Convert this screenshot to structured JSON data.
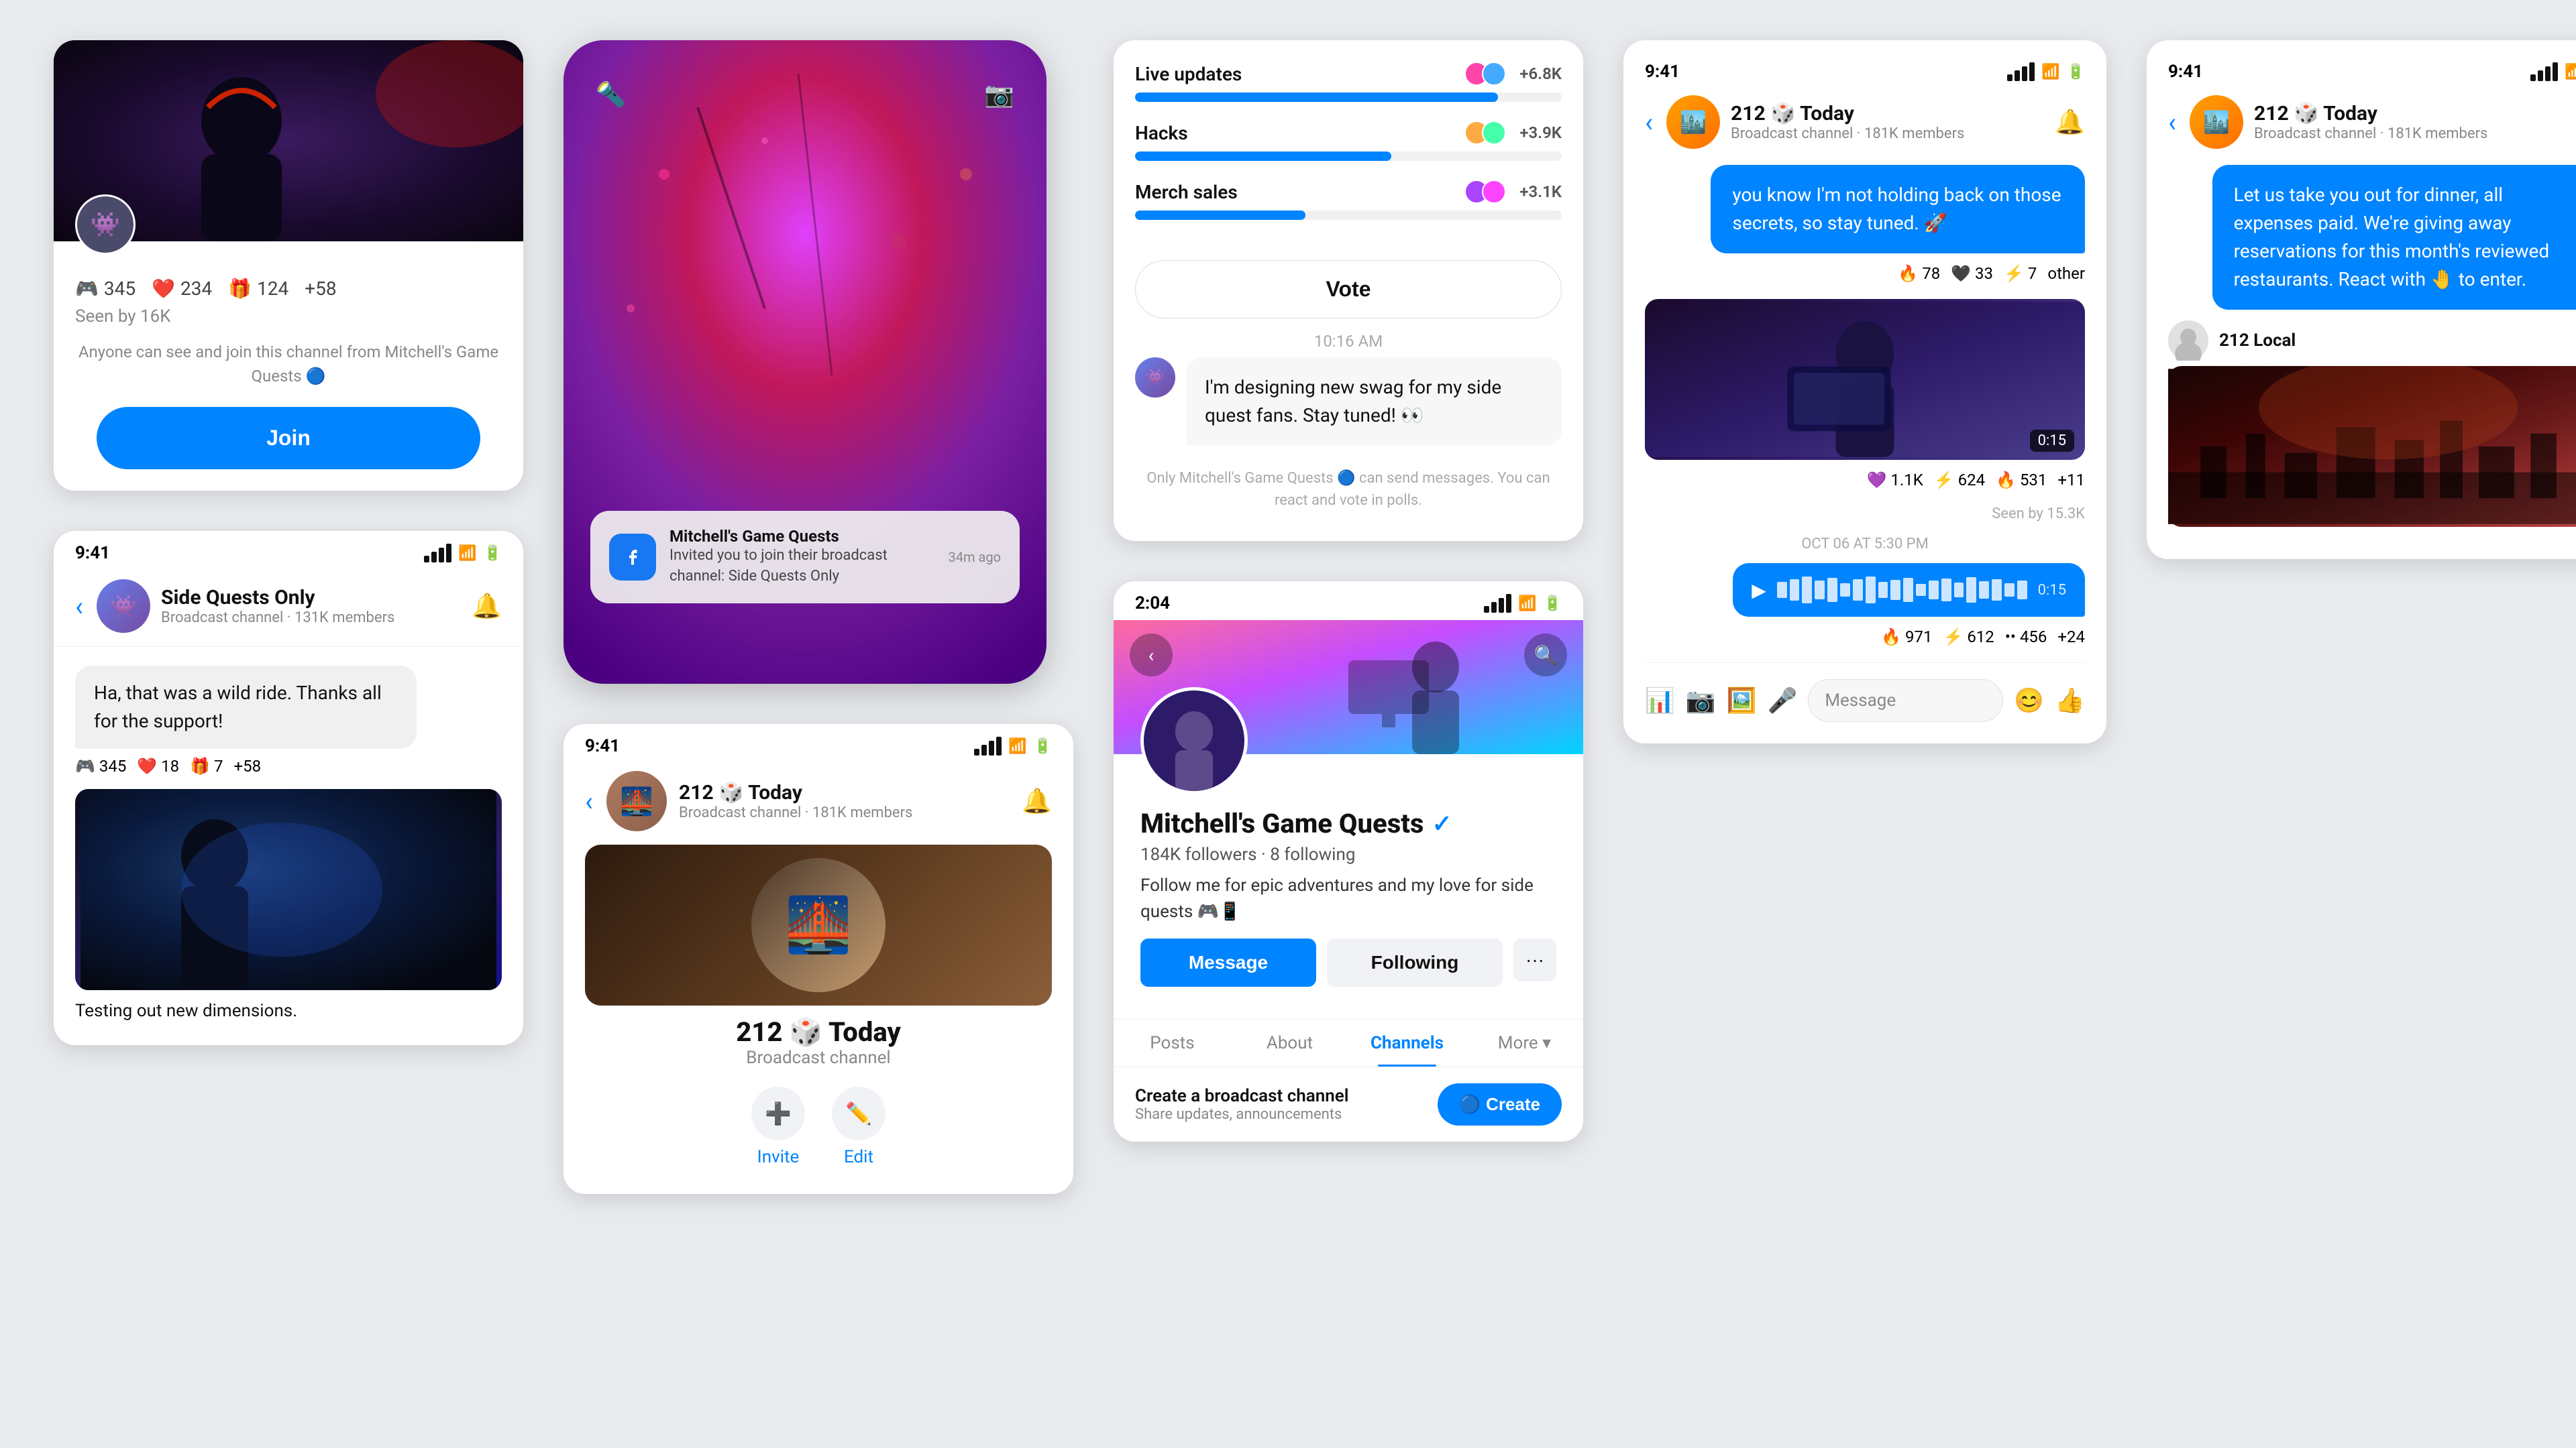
{
  "col1": {
    "channel_preview": {
      "reactions": [
        {
          "emoji": "🎮",
          "count": "345"
        },
        {
          "emoji": "❤️",
          "count": "234"
        },
        {
          "emoji": "🎁",
          "count": "124"
        },
        {
          "emoji": "plus",
          "count": "+58"
        }
      ],
      "seen_text": "Seen by 16K",
      "notice_text": "Anyone can see and join this channel from Mitchell's Game Quests",
      "join_label": "Join"
    },
    "chat": {
      "time": "9:41",
      "channel_name": "Side Quests Only",
      "channel_sub": "Broadcast channel · 131K members",
      "message": "Ha, that was a wild ride. Thanks all for the support!",
      "reactions": [
        {
          "emoji": "🎮",
          "count": "345"
        },
        {
          "emoji": "❤️",
          "count": "18"
        },
        {
          "emoji": "🎁",
          "count": "7"
        },
        {
          "emoji": "plus",
          "count": "+58"
        }
      ],
      "caption": "Testing out new dimensions."
    }
  },
  "col2": {
    "notification": {
      "sender": "Mitchell's Game Quests",
      "time_ago": "34m ago",
      "message": "Invited you to join their broadcast channel: Side Quests Only"
    },
    "admin": {
      "time": "9:41",
      "channel_name": "212 🎲 Today",
      "channel_sub": "Broadcast channel",
      "member_count": "181K members",
      "actions": [
        {
          "icon": "➕",
          "label": "Invite"
        },
        {
          "icon": "✏️",
          "label": "Edit"
        }
      ]
    }
  },
  "col3": {
    "poll": {
      "timestamp": "10:16 AM",
      "items": [
        {
          "label": "Live updates",
          "count": "+6.8K",
          "pct": 85
        },
        {
          "label": "Hacks",
          "count": "+3.9K",
          "pct": 60
        },
        {
          "label": "Merch sales",
          "count": "+3.1K",
          "pct": 40
        }
      ],
      "vote_label": "Vote",
      "swag_message": "I'm designing new swag for my side quest fans. Stay tuned! 👀",
      "admin_notice": "Only Mitchell's Game Quests 🔵 can send messages. You can react and vote in polls."
    },
    "profile": {
      "time": "2:04",
      "name": "Mitchell's Game Quests",
      "verified": true,
      "followers": "184K followers",
      "following": "8 following",
      "bio": "Follow me for epic adventures and my love for side quests 🎮📱",
      "tabs": [
        "Posts",
        "About",
        "Channels",
        "More"
      ],
      "active_tab": "Channels",
      "btns": {
        "message": "Message",
        "following": "Following",
        "more": "···"
      },
      "create_channel": {
        "title": "Create a broadcast channel",
        "sub": "Share updates, announcements",
        "btn": "Create"
      }
    }
  },
  "col4": {
    "thread": {
      "status_time": "9:41",
      "channel_name": "212 🎲 Today",
      "channel_sub": "Broadcast channel · 181K members",
      "message": "you know I'm not holding back on those secrets, so stay tuned. 🚀",
      "reactions": [
        {
          "emoji": "🔥",
          "count": "78"
        },
        {
          "emoji": "🖤",
          "count": "33"
        },
        {
          "emoji": "⚡",
          "count": "7"
        },
        {
          "emoji": "other",
          "count": "⏱️"
        }
      ],
      "video_duration": "0:15",
      "video_reactions": [
        {
          "emoji": "💜",
          "count": "1.1K"
        },
        {
          "emoji": "⚡",
          "count": "624"
        },
        {
          "emoji": "🔥",
          "count": "531"
        },
        {
          "emoji": "plus",
          "count": "+11"
        }
      ],
      "seen_by": "Seen by 15.3K",
      "date_divider": "OCT 06 AT 5:30 PM",
      "audio_duration": "0:15",
      "audio_reactions": [
        {
          "emoji": "🔥",
          "count": "971"
        },
        {
          "emoji": "⚡",
          "count": "612"
        },
        {
          "emoji": "••",
          "count": "456"
        },
        {
          "emoji": "plus",
          "count": "+24"
        }
      ],
      "input_placeholder": "Message"
    }
  },
  "col5": {
    "thread": {
      "status_time": "9:41",
      "channel_name": "212 🎲 Today",
      "channel_sub": "Broadcast channel · 181K members",
      "message": "Let us take you out for dinner, all expenses paid. We're giving away reservations for this month's reviewed restaurants. React with 🤚 to enter.",
      "sender_name": "212 Local"
    }
  }
}
